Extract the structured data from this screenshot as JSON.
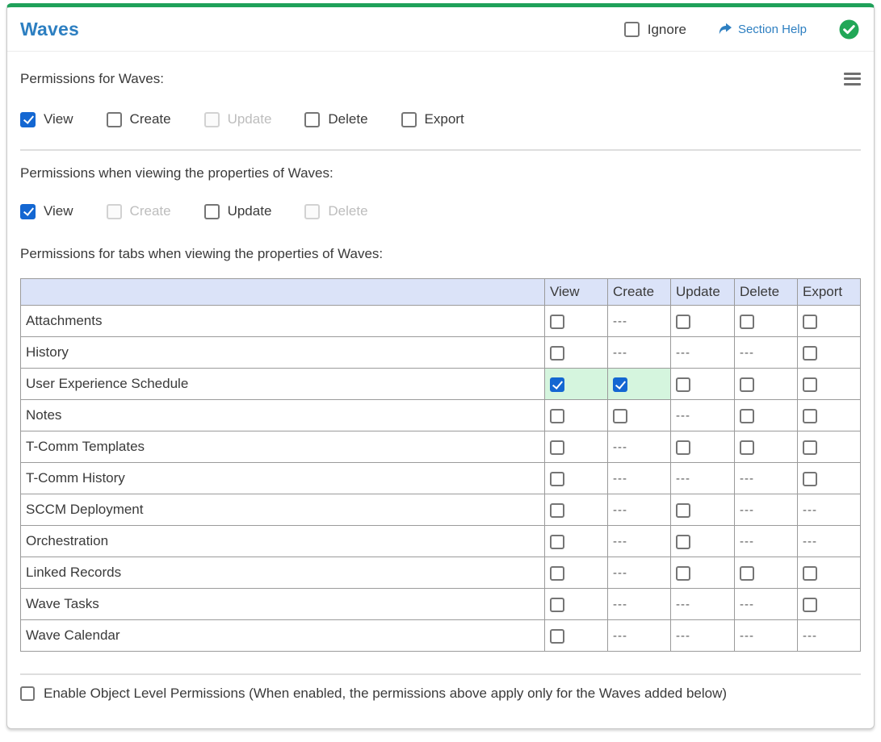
{
  "header": {
    "title": "Waves",
    "ignore_label": "Ignore",
    "ignore_checked": false,
    "section_help_label": "Section Help",
    "status_icon": "check-circle-green"
  },
  "colors": {
    "accent_green": "#1fa15a",
    "title_blue": "#2d7fc1",
    "link_blue": "#2d7fc1",
    "badge_green": "#21a757",
    "checkbox_checked_blue": "#1467d2",
    "table_header_bg": "#dbe3f8",
    "checked_cell_bg": "#d5f5de"
  },
  "sections": [
    {
      "label": "Permissions for Waves:",
      "options": [
        {
          "label": "View",
          "state": "checked"
        },
        {
          "label": "Create",
          "state": "unchecked"
        },
        {
          "label": "Update",
          "state": "disabled"
        },
        {
          "label": "Delete",
          "state": "unchecked"
        },
        {
          "label": "Export",
          "state": "unchecked"
        }
      ]
    },
    {
      "label": "Permissions when viewing the properties of Waves:",
      "options": [
        {
          "label": "View",
          "state": "checked"
        },
        {
          "label": "Create",
          "state": "disabled"
        },
        {
          "label": "Update",
          "state": "unchecked"
        },
        {
          "label": "Delete",
          "state": "disabled"
        }
      ]
    },
    {
      "label": "Permissions for tabs when viewing the properties of Waves:"
    }
  ],
  "table": {
    "columns": [
      "",
      "View",
      "Create",
      "Update",
      "Delete",
      "Export"
    ],
    "none_marker": "---",
    "rows": [
      {
        "label": "Attachments",
        "cells": [
          "unchecked",
          "none",
          "unchecked",
          "unchecked",
          "unchecked"
        ]
      },
      {
        "label": "History",
        "cells": [
          "unchecked",
          "none",
          "none",
          "none",
          "unchecked"
        ]
      },
      {
        "label": "User Experience Schedule",
        "cells": [
          "checked",
          "checked",
          "unchecked",
          "unchecked",
          "unchecked"
        ]
      },
      {
        "label": "Notes",
        "cells": [
          "unchecked",
          "unchecked",
          "none",
          "unchecked",
          "unchecked"
        ]
      },
      {
        "label": "T-Comm Templates",
        "cells": [
          "unchecked",
          "none",
          "unchecked",
          "unchecked",
          "unchecked"
        ]
      },
      {
        "label": "T-Comm History",
        "cells": [
          "unchecked",
          "none",
          "none",
          "none",
          "unchecked"
        ]
      },
      {
        "label": "SCCM Deployment",
        "cells": [
          "unchecked",
          "none",
          "unchecked",
          "none",
          "none"
        ]
      },
      {
        "label": "Orchestration",
        "cells": [
          "unchecked",
          "none",
          "unchecked",
          "none",
          "none"
        ]
      },
      {
        "label": "Linked Records",
        "cells": [
          "unchecked",
          "none",
          "unchecked",
          "unchecked",
          "unchecked"
        ]
      },
      {
        "label": "Wave Tasks",
        "cells": [
          "unchecked",
          "none",
          "none",
          "none",
          "unchecked"
        ]
      },
      {
        "label": "Wave Calendar",
        "cells": [
          "unchecked",
          "none",
          "none",
          "none",
          "none"
        ]
      }
    ]
  },
  "footer": {
    "enable_label": "Enable Object Level Permissions (When enabled, the permissions above apply only for the Waves added below)",
    "enable_checked": false
  }
}
